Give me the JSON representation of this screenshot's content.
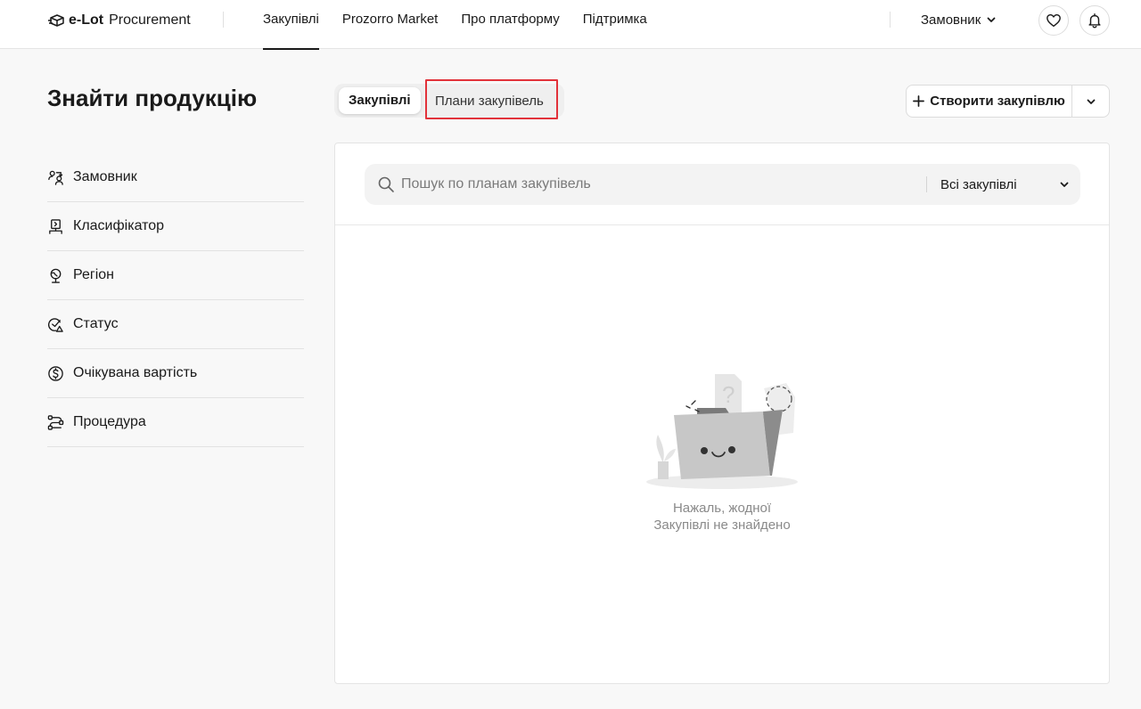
{
  "header": {
    "logo_brand": "e-Lot",
    "logo_sub": "Procurement",
    "nav": [
      {
        "label": "Закупівлі",
        "active": true
      },
      {
        "label": "Prozorro Market"
      },
      {
        "label": "Про платформу"
      },
      {
        "label": "Підтримка"
      }
    ],
    "role_label": "Замовник",
    "icons": [
      "heart-icon",
      "bell-icon"
    ]
  },
  "sidebar": {
    "title": "Знайти продукцію",
    "filters": [
      {
        "label": "Замовник",
        "icon": "customer-icon"
      },
      {
        "label": "Класифікатор",
        "icon": "classifier-icon"
      },
      {
        "label": "Регіон",
        "icon": "region-icon"
      },
      {
        "label": "Статус",
        "icon": "status-icon"
      },
      {
        "label": "Очікувана вартість",
        "icon": "dollar-icon"
      },
      {
        "label": "Процедура",
        "icon": "procedure-icon"
      }
    ]
  },
  "tabs": [
    {
      "label": "Закупівлі",
      "active": true
    },
    {
      "label": "Плани закупівель",
      "highlighted": true
    }
  ],
  "create_button": {
    "label": "Створити закупівлю"
  },
  "search": {
    "placeholder": "Пошук по планам закупівель",
    "value": "",
    "filter_selected": "Всі закупівлі"
  },
  "empty_state": {
    "line1": "Нажаль, жодної",
    "line2": "Закупівлі не знайдено"
  },
  "colors": {
    "highlight_border": "#e2323a",
    "text": "#1a1a1a",
    "muted": "#8a8a8a"
  }
}
